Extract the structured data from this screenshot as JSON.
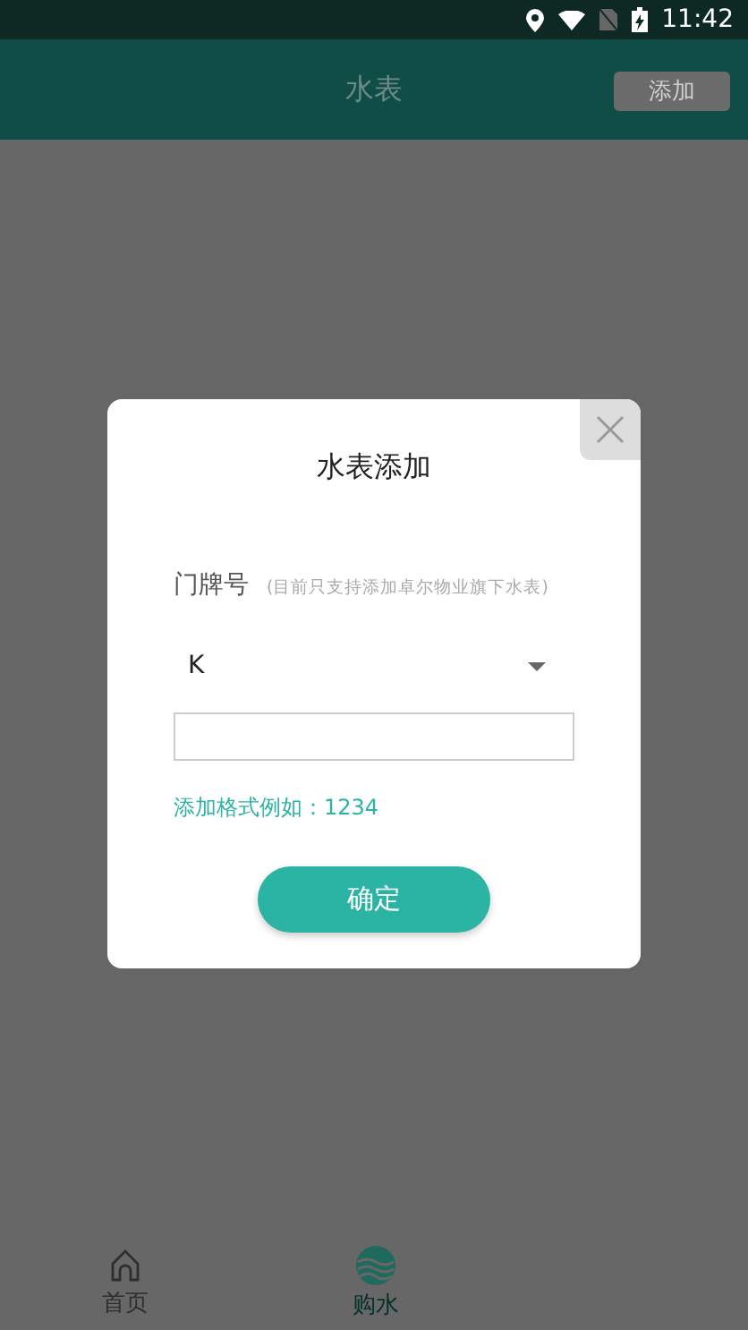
{
  "status_bar": {
    "time": "11:42"
  },
  "header": {
    "title": "水表",
    "action": "添加"
  },
  "dialog": {
    "title": "水表添加",
    "field_label": "门牌号",
    "field_note": "(目前只支持添加卓尔物业旗下水表)",
    "select_value": "K",
    "format_hint": "添加格式例如：1234",
    "confirm": "确定"
  },
  "tabs": [
    {
      "label": "首页",
      "kind": "home",
      "selected": false
    },
    {
      "label": "购水",
      "kind": "water",
      "selected": true
    }
  ]
}
